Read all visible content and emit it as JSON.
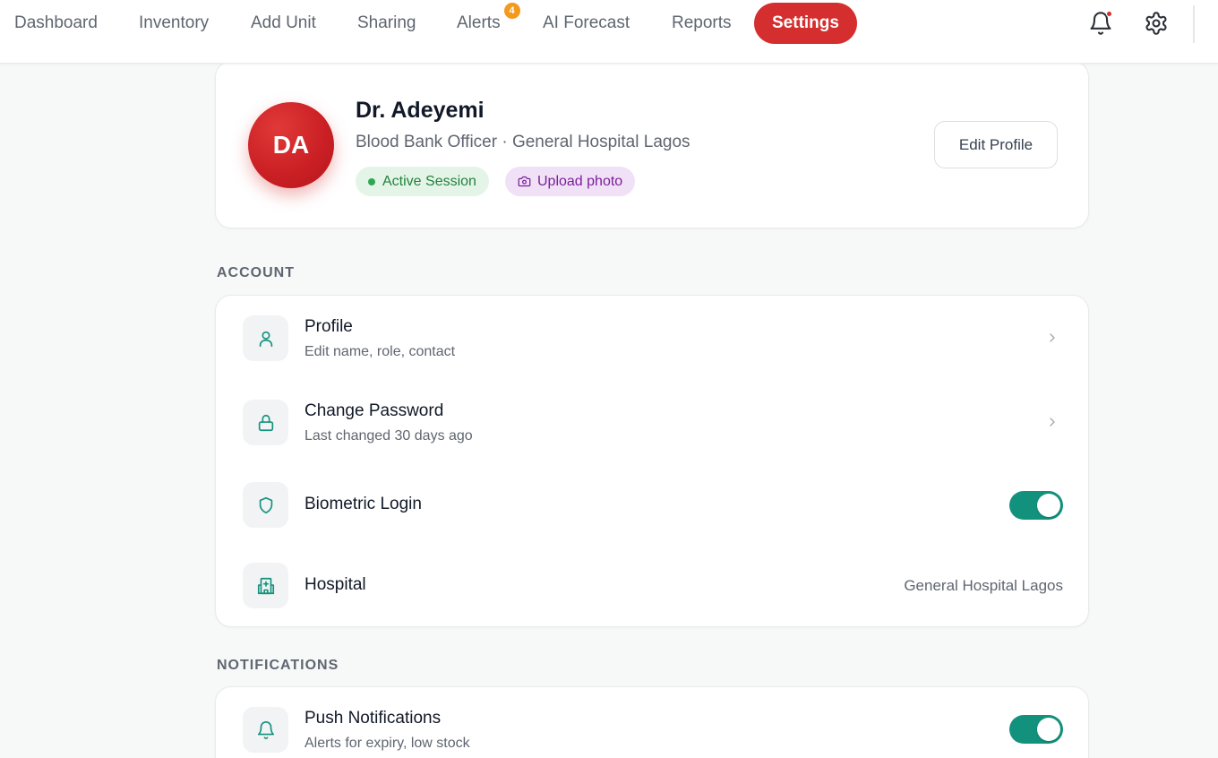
{
  "nav": {
    "items": [
      {
        "label": "Dashboard"
      },
      {
        "label": "Inventory"
      },
      {
        "label": "Add Unit"
      },
      {
        "label": "Sharing"
      },
      {
        "label": "Alerts",
        "badge": "4"
      },
      {
        "label": "AI Forecast"
      },
      {
        "label": "Reports"
      },
      {
        "label": "Settings",
        "active": true
      }
    ],
    "icons": [
      "bell-icon",
      "gear-icon"
    ]
  },
  "profile": {
    "initials": "DA",
    "name": "Dr. Adeyemi",
    "subtitle": "Blood Bank Officer · General Hospital Lagos",
    "status_label": "Active Session",
    "upload_label": "Upload photo",
    "edit_label": "Edit Profile"
  },
  "sections": {
    "account": {
      "label": "ACCOUNT",
      "rows": {
        "profile": {
          "title": "Profile",
          "subtitle": "Edit name, role, contact",
          "icon": "user-icon"
        },
        "password": {
          "title": "Change Password",
          "subtitle": "Last changed 30 days ago",
          "icon": "lock-icon"
        },
        "biometric": {
          "title": "Biometric Login",
          "icon": "shield-icon",
          "enabled": true
        },
        "hospital": {
          "title": "Hospital",
          "value": "General Hospital Lagos",
          "icon": "hospital-icon"
        }
      }
    },
    "notifications": {
      "label": "NOTIFICATIONS",
      "rows": {
        "push": {
          "title": "Push Notifications",
          "subtitle": "Alerts for expiry, low stock",
          "icon": "bell-icon",
          "enabled": true
        }
      }
    }
  },
  "colors": {
    "accent_red": "#d42e2e",
    "teal": "#12927d",
    "badge_orange": "#f39a1e",
    "status_green": "#23803d",
    "upload_purple": "#7a1f9a"
  }
}
